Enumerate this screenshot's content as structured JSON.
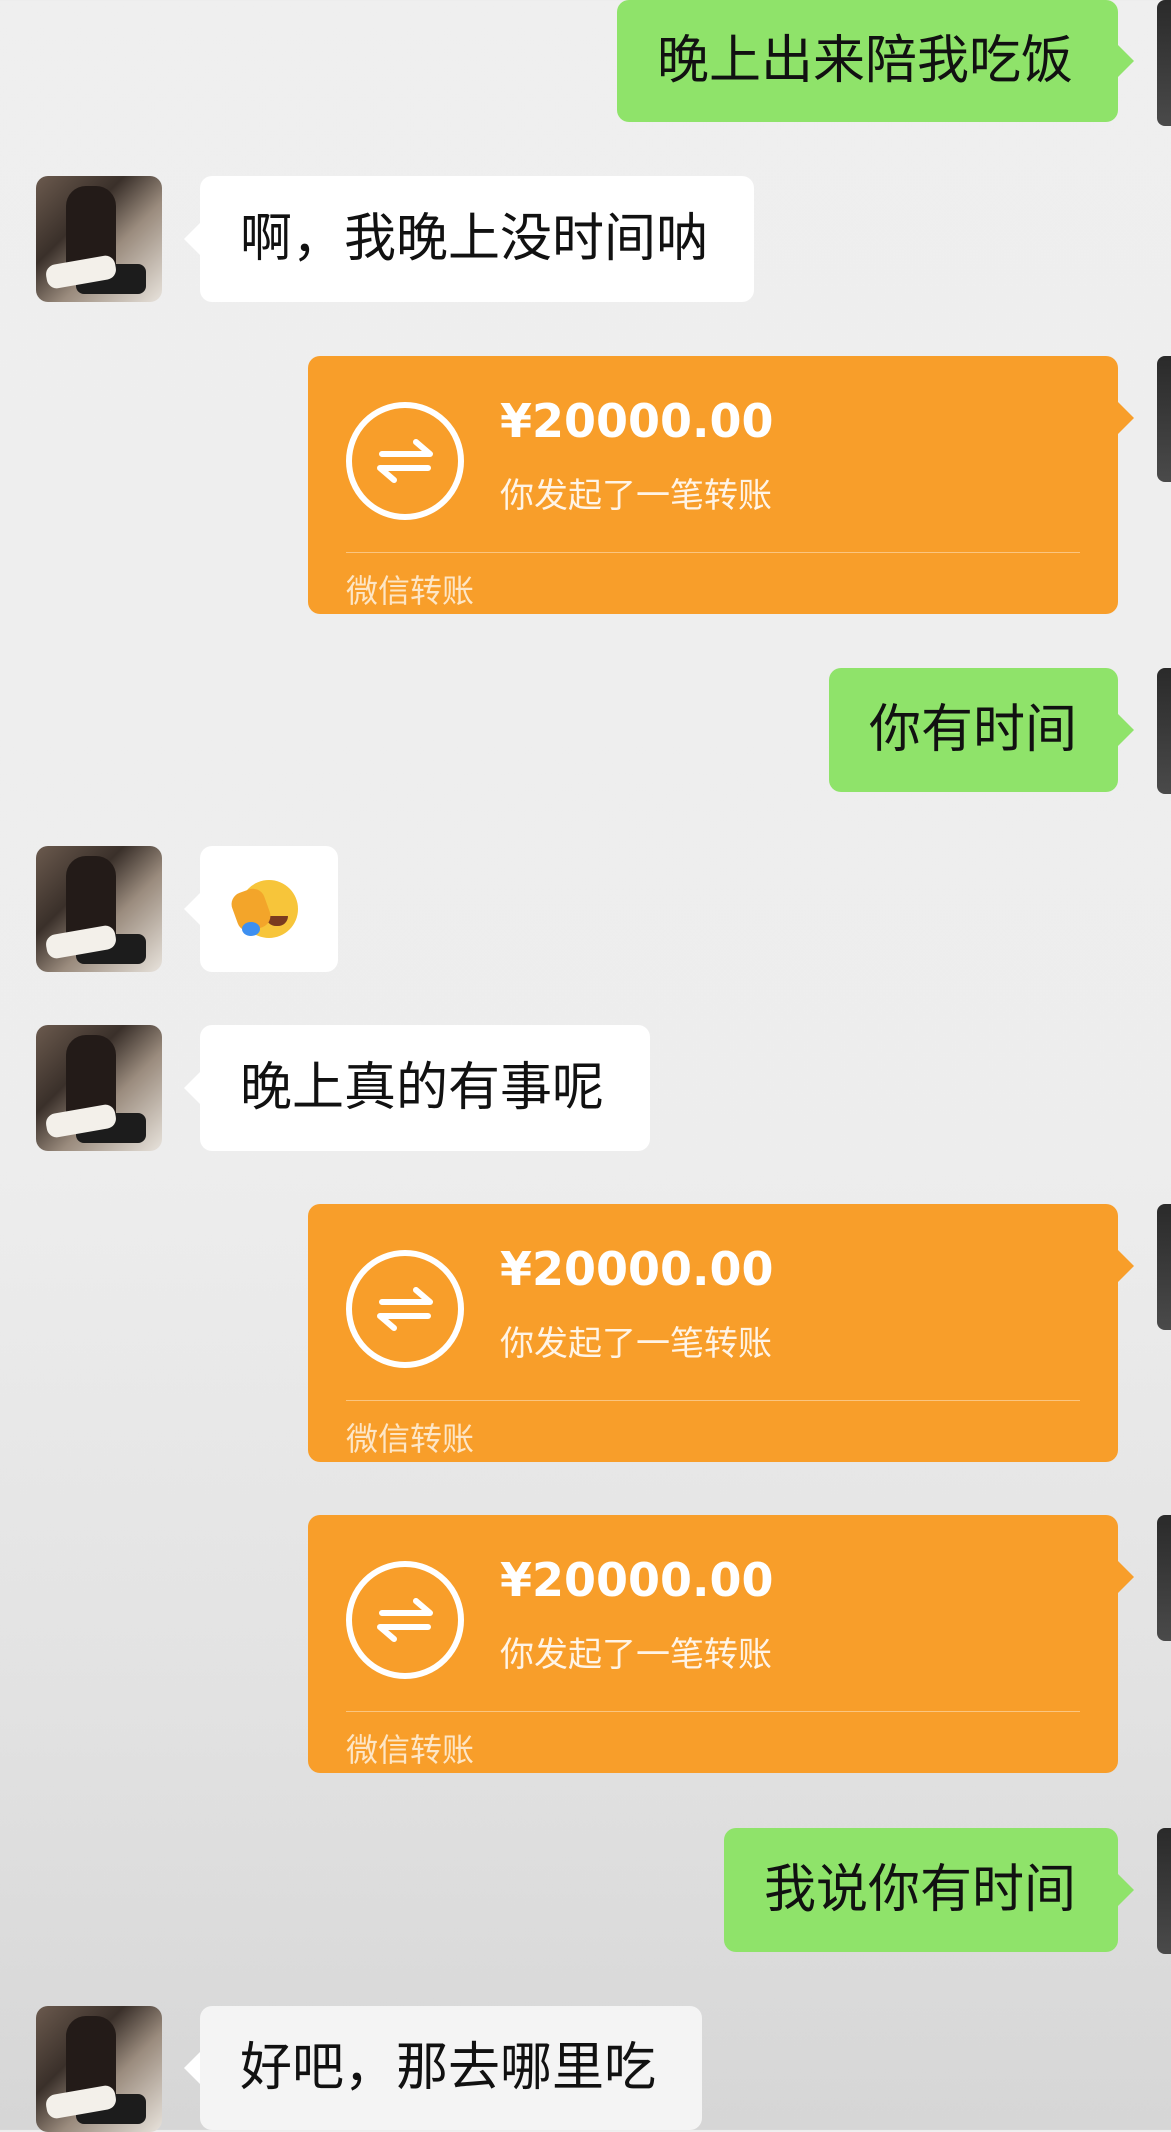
{
  "messages": {
    "m1": {
      "text": "晚上出来陪我吃饭"
    },
    "m2": {
      "text": "啊，我晚上没时间呐"
    },
    "m3": {
      "amount": "¥20000.00",
      "desc": "你发起了一笔转账",
      "footer": "微信转账"
    },
    "m4": {
      "text": "你有时间"
    },
    "m5": {
      "emoji": "face-palm-laughing-emoji"
    },
    "m6": {
      "text": "晚上真的有事呢"
    },
    "m7": {
      "amount": "¥20000.00",
      "desc": "你发起了一笔转账",
      "footer": "微信转账"
    },
    "m8": {
      "amount": "¥20000.00",
      "desc": "你发起了一笔转账",
      "footer": "微信转账"
    },
    "m9": {
      "text": "我说你有时间"
    },
    "m10": {
      "text": "好吧，那去哪里吃"
    }
  },
  "colors": {
    "outgoing_bubble": "#8fe36a",
    "incoming_bubble": "#ffffff",
    "transfer_card": "#f89e2a"
  }
}
